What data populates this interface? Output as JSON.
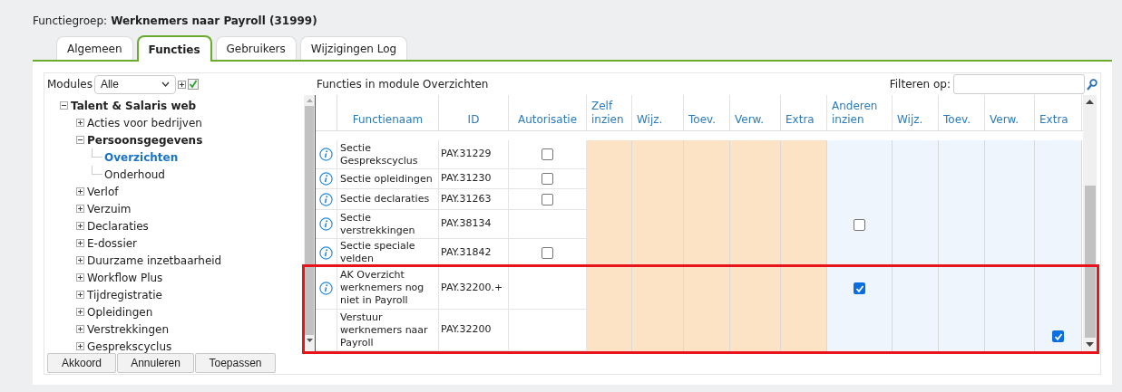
{
  "title": {
    "label": "Functiegroep:",
    "value": "Werknemers naar Payroll (31999)"
  },
  "tabs": [
    {
      "label": "Algemeen",
      "selected": false
    },
    {
      "label": "Functies",
      "selected": true
    },
    {
      "label": "Gebruikers",
      "selected": false
    },
    {
      "label": "Wijzigingen Log",
      "selected": false
    }
  ],
  "modules": {
    "label": "Modules",
    "value": "Alle",
    "checked": true
  },
  "tree": [
    {
      "label": "Talent & Salaris web",
      "expanded": true,
      "children": [
        {
          "label": "Acties voor bedrijven",
          "expanded": false
        },
        {
          "label": "Persoonsgegevens",
          "expanded": true,
          "children": [
            {
              "label": "Overzichten",
              "selected": true
            },
            {
              "label": "Onderhoud",
              "selected": false
            }
          ]
        },
        {
          "label": "Verlof",
          "expanded": false
        },
        {
          "label": "Verzuim",
          "expanded": false
        },
        {
          "label": "Declaraties",
          "expanded": false
        },
        {
          "label": "E-dossier",
          "expanded": false
        },
        {
          "label": "Duurzame inzetbaarheid",
          "expanded": false
        },
        {
          "label": "Workflow Plus",
          "expanded": false
        },
        {
          "label": "Tijdregistratie",
          "expanded": false
        },
        {
          "label": "Opleidingen",
          "expanded": false
        },
        {
          "label": "Verstrekkingen",
          "expanded": false
        },
        {
          "label": "Gesprekscyclus",
          "expanded": false
        }
      ]
    }
  ],
  "buttons": [
    "Akkoord",
    "Annuleren",
    "Toepassen"
  ],
  "table_title": "Functies in module Overzichten",
  "filter": {
    "label": "Filteren op:"
  },
  "columns": [
    {
      "label": "Functienaam",
      "kind": "plain"
    },
    {
      "label": "ID",
      "kind": "plain"
    },
    {
      "label": "Autorisatie",
      "kind": "plain"
    },
    {
      "label": "Zelf inzien",
      "kind": "zelf"
    },
    {
      "label": "Wijz.",
      "kind": "zelf"
    },
    {
      "label": "Toev.",
      "kind": "zelf"
    },
    {
      "label": "Verw.",
      "kind": "zelf"
    },
    {
      "label": "Extra",
      "kind": "zelf"
    },
    {
      "label": "Anderen inzien",
      "kind": "anderen"
    },
    {
      "label": "Wijz.",
      "kind": "anderen"
    },
    {
      "label": "Toev.",
      "kind": "anderen"
    },
    {
      "label": "Verw.",
      "kind": "anderen"
    },
    {
      "label": "Extra",
      "kind": "anderen"
    }
  ],
  "rows": [
    {
      "name": "Sectie Gesprekscyclus",
      "id": "PAY.31229",
      "info": true,
      "autorisatie_checked": false
    },
    {
      "name": "Sectie opleidingen",
      "id": "PAY.31230",
      "info": true,
      "autorisatie_checked": false
    },
    {
      "name": "Sectie declaraties",
      "id": "PAY.31263",
      "info": true,
      "autorisatie_checked": false
    },
    {
      "name": "Sectie verstrekkingen",
      "id": "PAY.38134",
      "info": true,
      "anderen_inzien_checked": false
    },
    {
      "name": "Sectie speciale velden",
      "id": "PAY.31842",
      "info": true,
      "autorisatie_checked": false
    }
  ],
  "highlighted_rows": [
    {
      "name": "AK Overzicht werknemers nog niet in Payroll",
      "id": "PAY.32200.+",
      "info": true,
      "anderen_inzien_checked": true
    },
    {
      "name": "Verstuur werknemers naar Payroll",
      "id": "PAY.32200",
      "info": false,
      "anderen_extra_checked": true
    }
  ]
}
